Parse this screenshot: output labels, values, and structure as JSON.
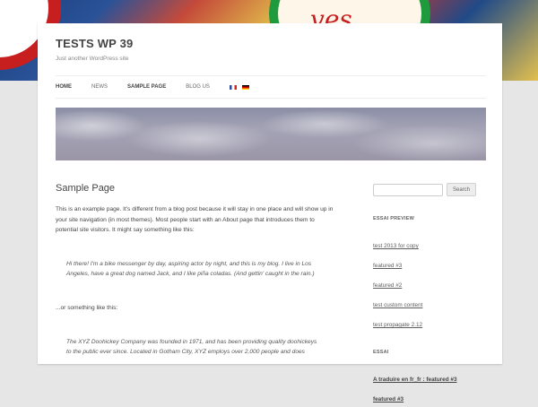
{
  "site": {
    "title": "TESTS WP 39",
    "description": "Just another WordPress site"
  },
  "background": {
    "logo_text": "ves"
  },
  "nav": {
    "items": [
      {
        "label": "HOME",
        "active": true
      },
      {
        "label": "NEWS",
        "active": false
      },
      {
        "label": "SAMPLE PAGE",
        "active": true
      },
      {
        "label": "BLOG US",
        "active": false
      }
    ],
    "flags": [
      "flag-fr-icon",
      "flag-de-icon"
    ]
  },
  "page": {
    "title": "Sample Page",
    "intro": "This is an example page. It's different from a blog post because it will stay in one place and will show up in your site navigation (in most themes). Most people start with an About page that introduces them to potential site visitors. It might say something like this:",
    "quote1": "Hi there! I'm a bike messenger by day, aspiring actor by night, and this is my blog. I live in Los Angeles, have a great dog named Jack, and I like piña coladas. (And gettin' caught in the rain.)",
    "middle": "...or something like this:",
    "quote2": "The XYZ Doohickey Company was founded in 1971, and has been providing quality doohickeys to the public ever since. Located in Gotham City, XYZ employs over 2,000 people and does"
  },
  "sidebar": {
    "search_placeholder": "",
    "search_button": "Search",
    "widget1": {
      "title": "ESSAI PREVIEW",
      "items": [
        "test 2013 for copy",
        "featured #3",
        "featured #2",
        "test custom content",
        "test propagate 2.12"
      ]
    },
    "widget2": {
      "title": "ESSAI",
      "items": [
        "A traduire en fr_fr : featured #3",
        "featured #3"
      ]
    }
  }
}
